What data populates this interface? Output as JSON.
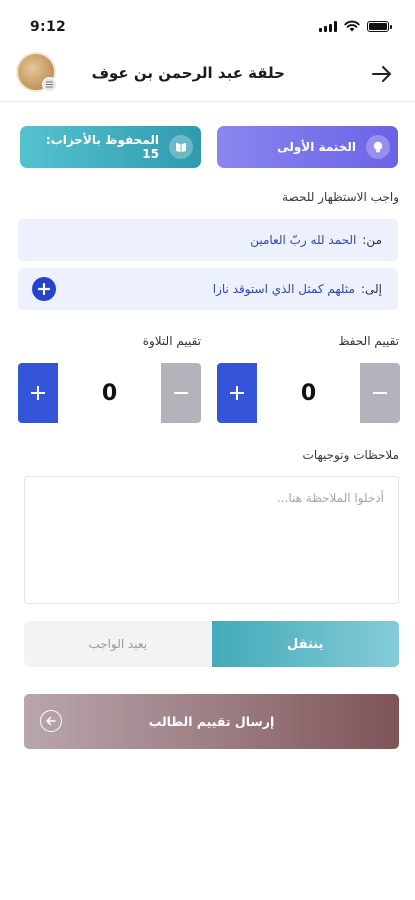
{
  "status_bar": {
    "time": "9:12"
  },
  "header": {
    "title": "حلقة عبد الرحمن بن عوف"
  },
  "cards": {
    "khatma": {
      "label": "الختمة الأولى"
    },
    "hifz": {
      "label": "المحفوظ بالأحزاب: 15"
    }
  },
  "homework": {
    "section_label": "واجب الاستظهار للحصة",
    "from_prefix": "من:",
    "from_value": "الحمد لله ربّ العامين",
    "to_prefix": "إلى:",
    "to_value": "مثلهم كمثل الذي استوقد نازا"
  },
  "ratings": {
    "hifz_label": "تقييم الحفظ",
    "hifz_value": "0",
    "tilawa_label": "تقييم التلاوة",
    "tilawa_value": "0"
  },
  "notes": {
    "label": "ملاحظات وتوجيهات",
    "placeholder": "أدخلوا الملاحظة هنا..."
  },
  "decision": {
    "move_label": "ينتقل",
    "repeat_label": "يعيد الواجب"
  },
  "submit": {
    "label": "إرسال تقييم الطالب"
  },
  "colors": {
    "khatma_card": "#6b63e6",
    "hifz_card": "#2f9aae",
    "primary_blue": "#3555d9",
    "submit": "#7e5458"
  },
  "icons": {
    "back": "arrow-right-icon",
    "khatma": "lightbulb-icon",
    "hifz": "book-icon",
    "add": "plus-icon",
    "submit": "arrow-left-circle-icon"
  }
}
